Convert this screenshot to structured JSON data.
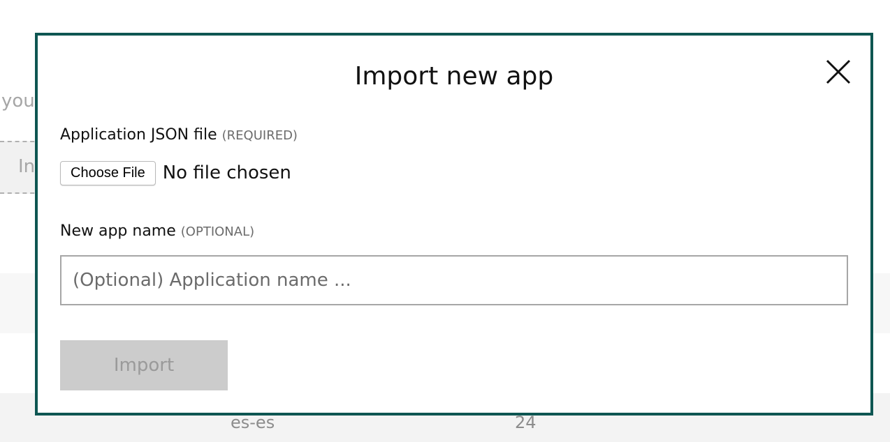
{
  "background": {
    "partial_text": "you",
    "import_fragment": "In",
    "row": {
      "locale": "es-es",
      "count": "24"
    }
  },
  "modal": {
    "title": "Import new app",
    "close_icon": "close-icon",
    "json_field": {
      "label": "Application JSON file",
      "hint": "(REQUIRED)",
      "choose_button": "Choose File",
      "status": "No file chosen"
    },
    "name_field": {
      "label": "New app name",
      "hint": "(OPTIONAL)",
      "placeholder": "(Optional) Application name ...",
      "value": ""
    },
    "import_button": "Import"
  },
  "colors": {
    "modal_border": "#0e5652",
    "disabled_button_bg": "#cccccc",
    "disabled_button_text": "#9a9a9a"
  }
}
